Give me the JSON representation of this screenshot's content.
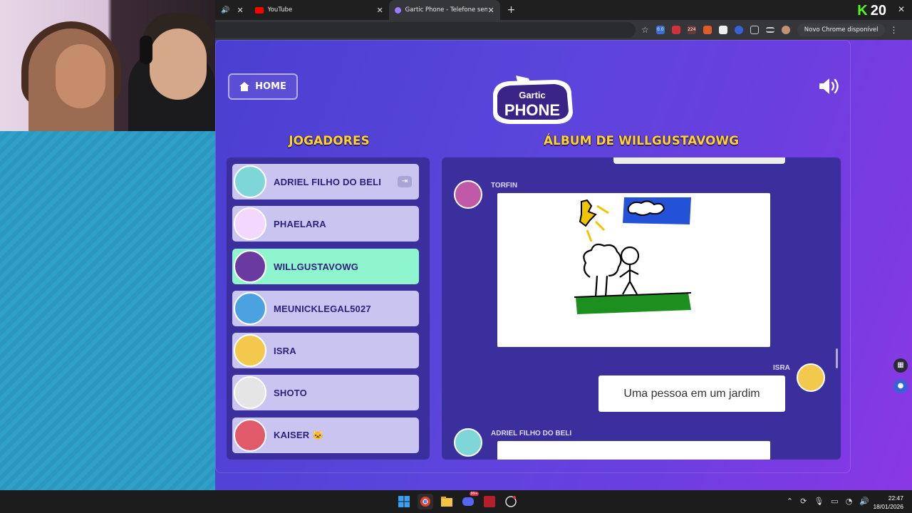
{
  "browser": {
    "tabs": [
      {
        "label": "YouTube",
        "favicon_color": "#ff0000"
      },
      {
        "label": "Gartic Phone - Telefone sem fio",
        "favicon_color": "#9b7bff"
      }
    ],
    "new_tab": "+",
    "update_label": "Novo Chrome disponível",
    "badges": [
      "0.0",
      "224"
    ]
  },
  "kick_overlay": {
    "k": "K",
    "count": "20"
  },
  "game": {
    "home_label": "HOME",
    "logo_line1": "Gartic",
    "logo_line2": "PHONE",
    "players_heading": "JOGADORES",
    "album_heading": "ÁLBUM DE WILLGUSTAVOWG",
    "players": [
      {
        "name": "ADRIEL FILHO DO BELI",
        "active": false,
        "color": "#7fd6d9"
      },
      {
        "name": "PHAELARA",
        "active": false,
        "color": "#f4d7ff"
      },
      {
        "name": "WILLGUSTAVOWG",
        "active": true,
        "color": "#6b3aa0"
      },
      {
        "name": "MEUNICKLEGAL5027",
        "active": false,
        "color": "#4aa3e0"
      },
      {
        "name": "ISRA",
        "active": false,
        "color": "#f2c94c"
      },
      {
        "name": "SHOTO",
        "active": false,
        "color": "#e5e5e5"
      },
      {
        "name": "KAISER 🐱",
        "active": false,
        "color": "#e05a6a"
      }
    ],
    "album": {
      "entry1_author": "TORFIN",
      "entry2_author": "ISRA",
      "entry2_text": "Uma pessoa em um jardim",
      "entry3_author": "ADRIEL FILHO DO BELI"
    }
  },
  "taskbar": {
    "time": "22:47",
    "date": "18/01/2026",
    "badge": "99+"
  }
}
